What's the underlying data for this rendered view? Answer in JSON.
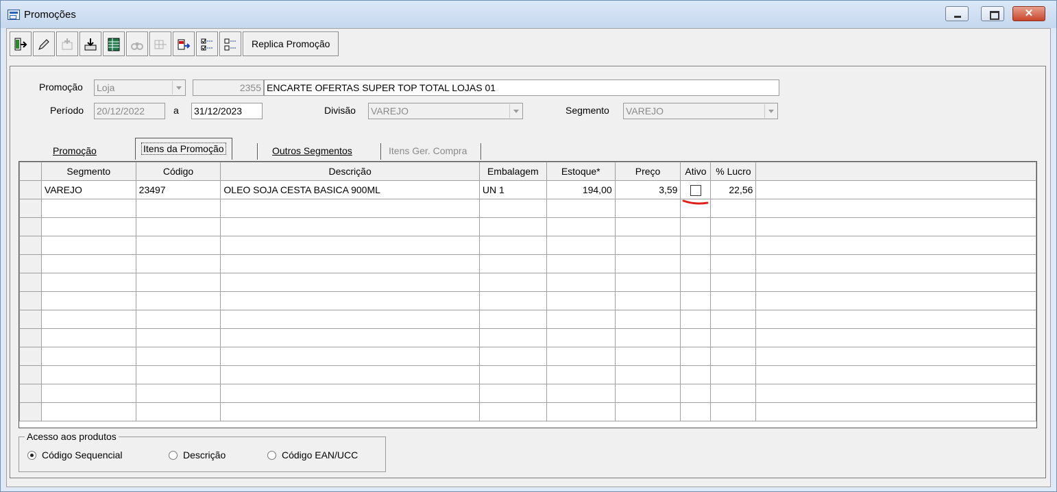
{
  "window": {
    "title": "Promoções"
  },
  "toolbar": {
    "replica_label": "Replica Promoção"
  },
  "header": {
    "promocao_label": "Promoção",
    "tipo_value": "Loja",
    "numero_value": "2355",
    "descricao_value": "ENCARTE OFERTAS SUPER TOP TOTAL LOJAS 01",
    "periodo_label": "Período",
    "data_inicio": "20/12/2022",
    "a_label": "a",
    "data_fim": "31/12/2023",
    "divisao_label": "Divisão",
    "divisao_value": "VAREJO",
    "segmento_label": "Segmento",
    "segmento_value": "VAREJO"
  },
  "tabs": [
    {
      "label": "Promoção"
    },
    {
      "label": "Itens da Promoção"
    },
    {
      "label": "Outros Segmentos"
    },
    {
      "label": "Itens Ger. Compra"
    }
  ],
  "grid": {
    "columns": [
      "Segmento",
      "Código",
      "Descrição",
      "Embalagem",
      "Estoque*",
      "Preço",
      "Ativo",
      "% Lucro"
    ],
    "rows": [
      {
        "segmento": "VAREJO",
        "codigo": "23497",
        "descricao": "OLEO SOJA CESTA BASICA 900ML",
        "embalagem": "UN  1",
        "estoque": "194,00",
        "preco": "3,59",
        "ativo": false,
        "lucro": "22,56"
      }
    ]
  },
  "acesso": {
    "title": "Acesso aos produtos",
    "options": [
      "Código Sequencial",
      "Descrição",
      "Código EAN/UCC"
    ],
    "selected": "Código Sequencial"
  },
  "colors": {
    "annotation": "#e0201a",
    "titlebar": "#c5d8ee"
  }
}
